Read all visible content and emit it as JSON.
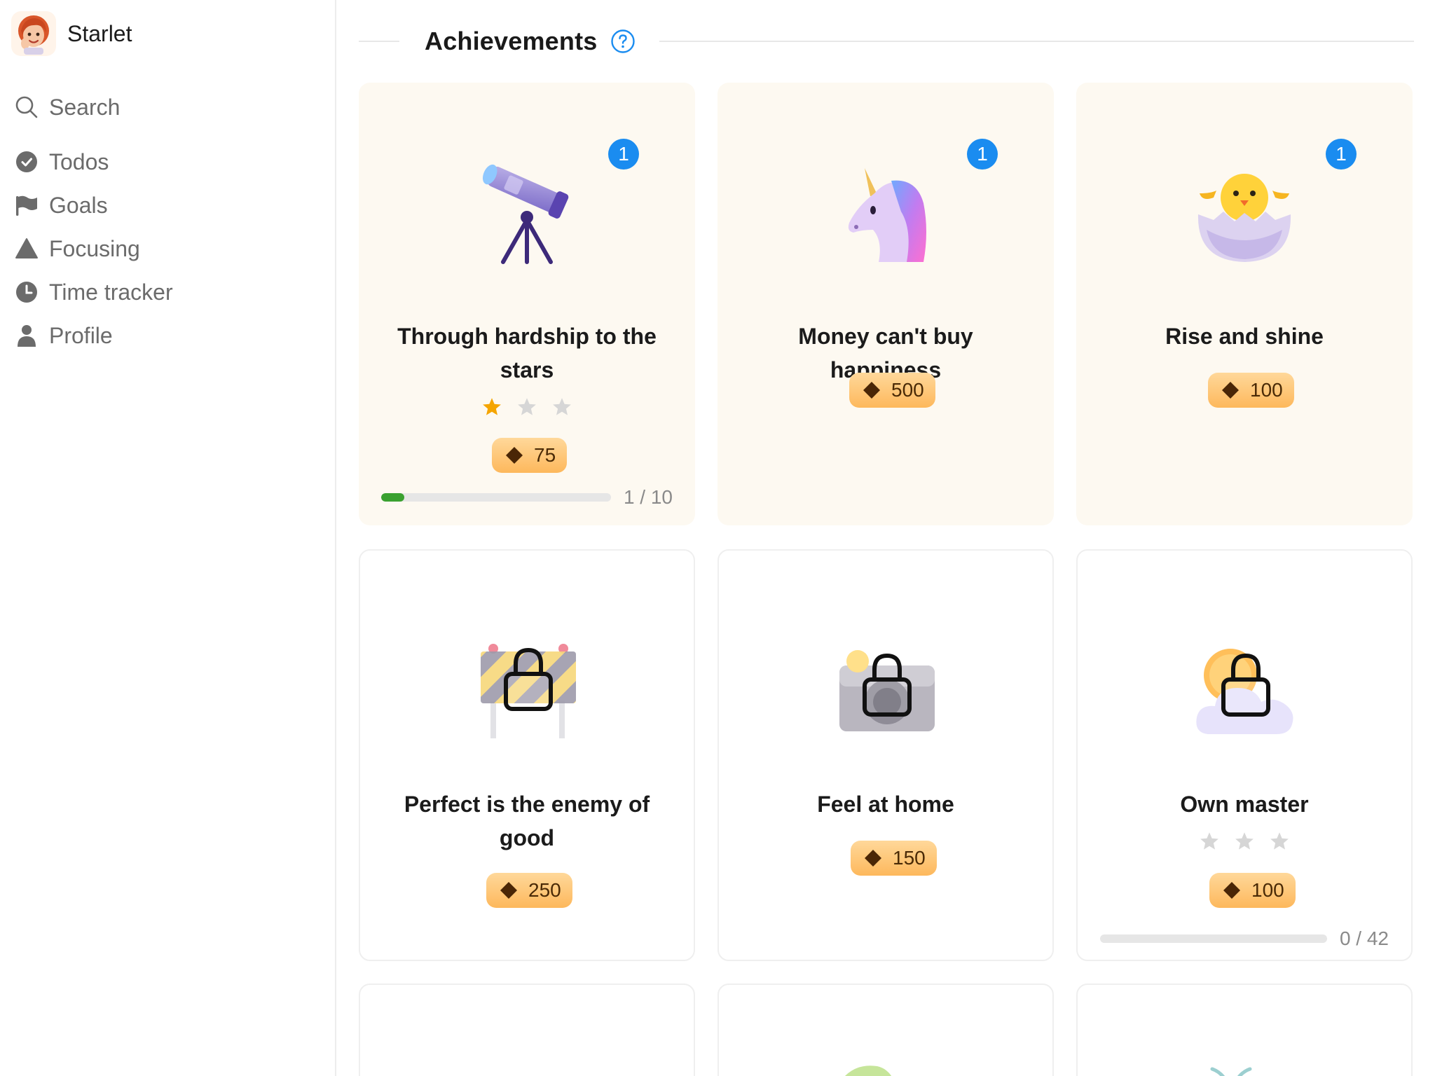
{
  "app": {
    "name": "Starlet"
  },
  "nav": [
    {
      "label": "Search",
      "icon": "search-icon"
    },
    {
      "label": "Todos",
      "icon": "check-circle-icon"
    },
    {
      "label": "Goals",
      "icon": "flag-icon"
    },
    {
      "label": "Focusing",
      "icon": "triangle-icon"
    },
    {
      "label": "Time tracker",
      "icon": "clock-icon"
    },
    {
      "label": "Profile",
      "icon": "person-icon"
    }
  ],
  "section": {
    "title": "Achievements",
    "help_icon": "help-icon"
  },
  "achievements": [
    {
      "title": "Through hardship to the stars",
      "icon": "telescope-icon",
      "count": "1",
      "stars": 3,
      "stars_filled": 1,
      "reward": "75",
      "progress_text": "1 / 10",
      "progress": 0.1,
      "state": "earned"
    },
    {
      "title": "Money can't buy happiness",
      "icon": "unicorn-icon",
      "count": "1",
      "reward": "500",
      "state": "earned"
    },
    {
      "title": "Rise and shine",
      "icon": "hatching-chick-icon",
      "count": "1",
      "reward": "100",
      "state": "earned"
    },
    {
      "title": "Perfect is the enemy of good",
      "icon": "construction-barrier-lock-icon",
      "reward": "250",
      "state": "locked"
    },
    {
      "title": "Feel at home",
      "icon": "camera-lock-icon",
      "reward": "150",
      "state": "locked"
    },
    {
      "title": "Own master",
      "icon": "sun-cloud-lock-icon",
      "stars": 3,
      "stars_filled": 0,
      "reward": "100",
      "progress_text": "0 / 42",
      "progress": 0,
      "state": "locked"
    }
  ],
  "colors": {
    "accent_blue": "#1a8cf0",
    "progress_green": "#3aa130",
    "star_gold": "#f5a500",
    "earned_card_bg": "#fdf9f1"
  }
}
